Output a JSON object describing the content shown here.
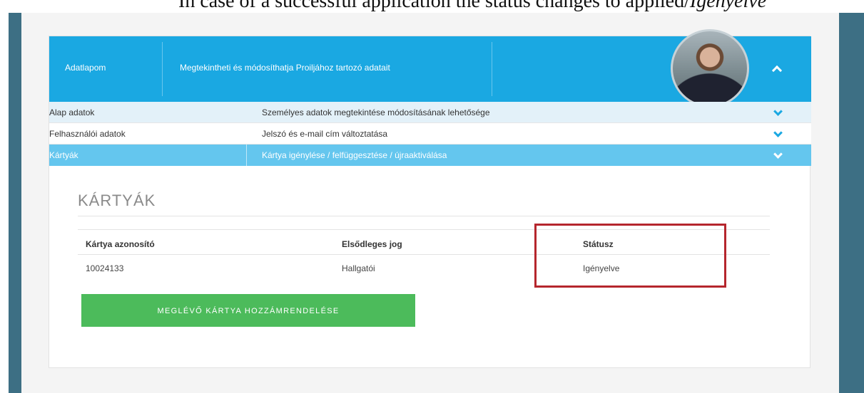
{
  "caption": {
    "text": "In case of a successful application the status changes to applied/",
    "em": "Igényelve"
  },
  "header": {
    "title": "Adatlapom",
    "subtitle": "Megtekintheti és módosíthatja Proiljához tartozó adatait"
  },
  "avatar": {
    "alt": "profile-portrait"
  },
  "accordion": {
    "rows": [
      {
        "label": "Alap adatok",
        "desc": "Személyes adatok megtekintése módosításának lehetősége"
      },
      {
        "label": "Felhasználói adatok",
        "desc": "Jelszó és e-mail cím változtatása"
      },
      {
        "label": "Kártyák",
        "desc": "Kártya igénylése / felfüggesztése / újraaktiválása"
      }
    ]
  },
  "cards": {
    "title": "KÁRTYÁK",
    "columns": [
      "Kártya azonosító",
      "Elsődleges jog",
      "Státusz"
    ],
    "rows": [
      {
        "id": "10024133",
        "right": "Hallgatói",
        "status": "Igényelve"
      }
    ],
    "assign_button": "MEGLÉVŐ KÁRTYA HOZZÁMRENDELÉSE"
  },
  "colors": {
    "primary": "#1aa8e2",
    "active_row": "#64c6ee",
    "button": "#4cbb5b",
    "highlight": "#b5262d"
  }
}
